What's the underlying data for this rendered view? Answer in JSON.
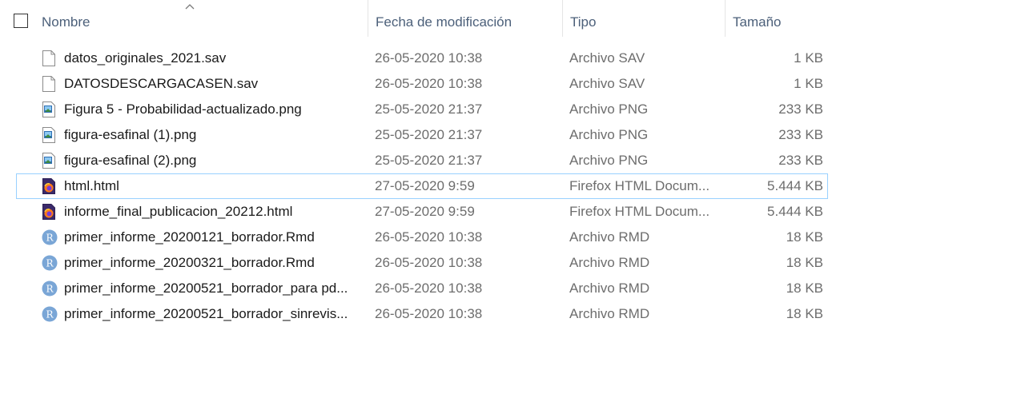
{
  "header": {
    "name": "Nombre",
    "date": "Fecha de modificación",
    "type": "Tipo",
    "size": "Tamaño"
  },
  "files": [
    {
      "name": "datos_originales_2021.sav",
      "date": "26-05-2020 10:38",
      "type": "Archivo SAV",
      "size": "1 KB",
      "icon": "blank-file-icon"
    },
    {
      "name": "DATOSDESCARGACASEN.sav",
      "date": "26-05-2020 10:38",
      "type": "Archivo SAV",
      "size": "1 KB",
      "icon": "blank-file-icon"
    },
    {
      "name": "Figura 5 - Probabilidad-actualizado.png",
      "date": "25-05-2020 21:37",
      "type": "Archivo PNG",
      "size": "233 KB",
      "icon": "image-file-icon"
    },
    {
      "name": "figura-esafinal (1).png",
      "date": "25-05-2020 21:37",
      "type": "Archivo PNG",
      "size": "233 KB",
      "icon": "image-file-icon"
    },
    {
      "name": "figura-esafinal (2).png",
      "date": "25-05-2020 21:37",
      "type": "Archivo PNG",
      "size": "233 KB",
      "icon": "image-file-icon"
    },
    {
      "name": "html.html",
      "date": "27-05-2020 9:59",
      "type": "Firefox HTML Docum...",
      "size": "5.444 KB",
      "icon": "firefox-html-icon",
      "selected": true
    },
    {
      "name": "informe_final_publicacion_20212.html",
      "date": "27-05-2020 9:59",
      "type": "Firefox HTML Docum...",
      "size": "5.444 KB",
      "icon": "firefox-html-icon"
    },
    {
      "name": "primer_informe_20200121_borrador.Rmd",
      "date": "26-05-2020 10:38",
      "type": "Archivo RMD",
      "size": "18 KB",
      "icon": "r-file-icon"
    },
    {
      "name": "primer_informe_20200321_borrador.Rmd",
      "date": "26-05-2020 10:38",
      "type": "Archivo RMD",
      "size": "18 KB",
      "icon": "r-file-icon"
    },
    {
      "name": "primer_informe_20200521_borrador_para pd...",
      "date": "26-05-2020 10:38",
      "type": "Archivo RMD",
      "size": "18 KB",
      "icon": "r-file-icon"
    },
    {
      "name": "primer_informe_20200521_borrador_sinrevis...",
      "date": "26-05-2020 10:38",
      "type": "Archivo RMD",
      "size": "18 KB",
      "icon": "r-file-icon"
    }
  ]
}
